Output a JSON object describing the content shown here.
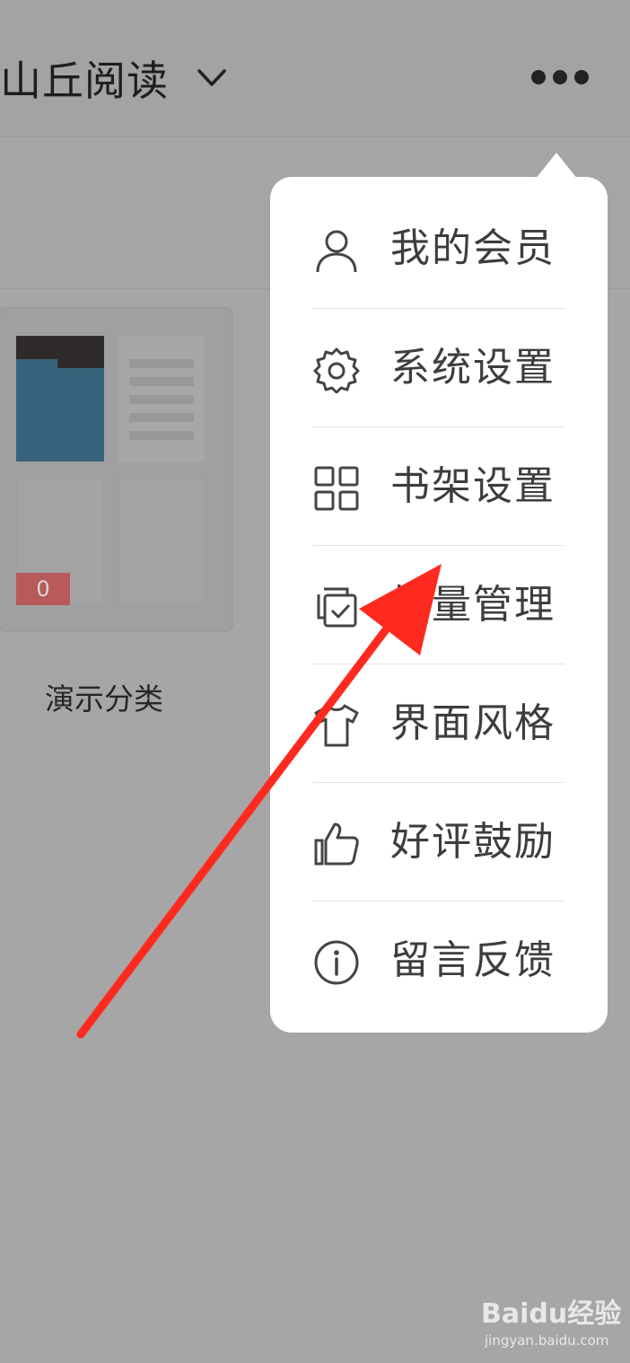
{
  "header": {
    "title": "山丘阅读",
    "dropdown_icon": "chevron-down-icon",
    "more_icon": "more-dots-icon"
  },
  "category": {
    "label": "演示分类",
    "count": "0",
    "folder_color": "#37627b",
    "badge_color": "#b85a5a"
  },
  "menu": {
    "items": [
      {
        "label": "我的会员",
        "icon": "user-icon"
      },
      {
        "label": "系统设置",
        "icon": "gear-icon"
      },
      {
        "label": "书架设置",
        "icon": "grid-icon"
      },
      {
        "label": "批量管理",
        "icon": "batch-check-icon"
      },
      {
        "label": "界面风格",
        "icon": "shirt-icon"
      },
      {
        "label": "好评鼓励",
        "icon": "thumbs-up-icon"
      },
      {
        "label": "留言反馈",
        "icon": "info-icon"
      }
    ]
  },
  "annotation": {
    "arrow_color": "#ff2a1f"
  },
  "watermark": {
    "logo_text": "Baidu经验",
    "url_text": "jingyan.baidu.com"
  }
}
